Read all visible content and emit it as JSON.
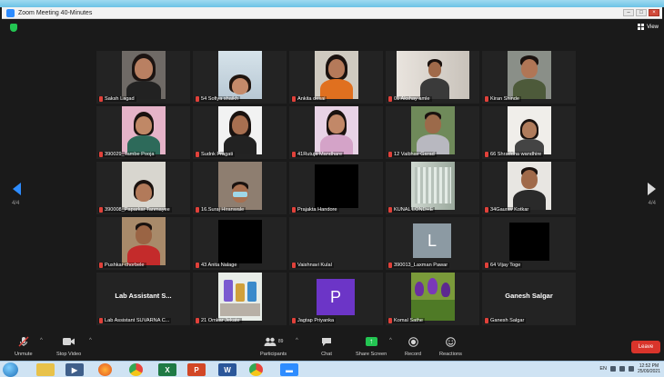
{
  "window": {
    "title": "Zoom Meeting 40-Minutes"
  },
  "header": {
    "view_label": "View"
  },
  "pager": {
    "left": "4/4",
    "right": "4/4"
  },
  "participants": [
    {
      "name": "Saksh Lagad",
      "kind": "video"
    },
    {
      "name": "54 Sofiya shaikh",
      "kind": "video"
    },
    {
      "name": "Ankita desai",
      "kind": "video"
    },
    {
      "name": "01 Akshay amle",
      "kind": "video"
    },
    {
      "name": "Kiran Shinde",
      "kind": "video"
    },
    {
      "name": "390029_Tambe Pooja",
      "kind": "video"
    },
    {
      "name": "Sudnk Pragati",
      "kind": "video"
    },
    {
      "name": "41Rutuja Mandhare",
      "kind": "video"
    },
    {
      "name": "12 Vaibhav Garad",
      "kind": "video"
    },
    {
      "name": "66 Shraddha wandhire",
      "kind": "video"
    },
    {
      "name": "390008_Paparkar Tanmayee",
      "kind": "video"
    },
    {
      "name": "16.Suraj Hiranwale",
      "kind": "video"
    },
    {
      "name": "Prajakta Handore",
      "kind": "black"
    },
    {
      "name": "KUNAL LONDHE",
      "kind": "video"
    },
    {
      "name": "34Gaurav Kotkar",
      "kind": "video"
    },
    {
      "name": "Pushkar chorbele",
      "kind": "video"
    },
    {
      "name": "43 Anita Nalage",
      "kind": "black"
    },
    {
      "name": "Vaishnavi Kulal",
      "kind": "empty"
    },
    {
      "name": "390013_Laxman Pawar",
      "kind": "avatar",
      "letter": "L"
    },
    {
      "name": "64 Vijay Toge",
      "kind": "black"
    },
    {
      "name": "Lab Assistant SUVARNA C...",
      "kind": "text",
      "display": "Lab Assistant S..."
    },
    {
      "name": "21 Omkar Jekate",
      "kind": "video"
    },
    {
      "name": "Jagtap Priyanka",
      "kind": "avatar",
      "letter": "P"
    },
    {
      "name": "Komal Sathe",
      "kind": "video"
    },
    {
      "name": "Ganesh Salgar",
      "kind": "text",
      "display": "Ganesh Salgar"
    }
  ],
  "toolbar": {
    "unmute": "Unmute",
    "stop_video": "Stop Video",
    "participants": "Participants",
    "participants_count": "89",
    "chat": "Chat",
    "share_screen": "Share Screen",
    "record": "Record",
    "reactions": "Reactions",
    "leave": "Leave"
  },
  "taskbar": {
    "lang": "EN",
    "time": "12:52 PM",
    "date": "25/09/2021"
  },
  "colors": {
    "accent": "#2d8cff",
    "leave": "#d9342b",
    "share": "#23c552",
    "avatar_l": "#8c9aa3",
    "avatar_p": "#6c35c7"
  }
}
